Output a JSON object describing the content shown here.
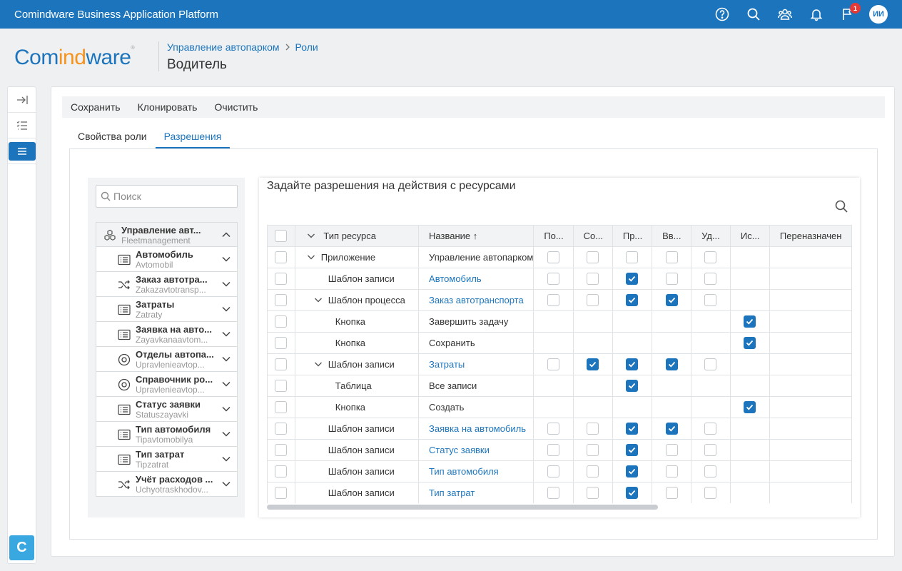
{
  "app": {
    "title": "Comindware Business Application Platform",
    "notifications_count": "1",
    "user_initials": "ИИ"
  },
  "logo": {
    "part1": "Com",
    "part2": "ind",
    "part3": "ware",
    "mark": "®"
  },
  "breadcrumb": {
    "items": [
      "Управление автопарком",
      "Роли"
    ]
  },
  "page": {
    "title": "Водитель"
  },
  "rail": {
    "logo_letter": "C"
  },
  "toolbar": {
    "save": "Сохранить",
    "clone": "Клонировать",
    "clear": "Очистить"
  },
  "tabs": [
    {
      "label": "Свойства роли"
    },
    {
      "label": "Разрешения"
    }
  ],
  "search": {
    "placeholder": "Поиск"
  },
  "tree": {
    "root": {
      "name": "Управление авт...",
      "sub": "Fleetmanagement"
    },
    "items": [
      {
        "name": "Автомобиль",
        "sub": "Avtomobil",
        "icon": "list-icon"
      },
      {
        "name": "Заказ автотра...",
        "sub": "Zakazavtotransp...",
        "icon": "shuffle-icon"
      },
      {
        "name": "Затраты",
        "sub": "Zatraty",
        "icon": "list-icon"
      },
      {
        "name": "Заявка на авто...",
        "sub": "Zayavkanaavtom...",
        "icon": "list-icon"
      },
      {
        "name": "Отделы автопа...",
        "sub": "Upravlenieavtop...",
        "icon": "circle-icon"
      },
      {
        "name": "Справочник ро...",
        "sub": "Upravlenieavtop...",
        "icon": "circle-icon"
      },
      {
        "name": "Статус заявки",
        "sub": "Statuszayavki",
        "icon": "list-icon"
      },
      {
        "name": "Тип автомобиля",
        "sub": "Tipavtomobilya",
        "icon": "list-icon"
      },
      {
        "name": "Тип затрат",
        "sub": "Tipzatrat",
        "icon": "list-icon"
      },
      {
        "name": "Учёт расходов ...",
        "sub": "Uchyotraskhodov...",
        "icon": "shuffle-icon"
      }
    ]
  },
  "grid": {
    "title": "Задайте разрешения на действия с ресурсами",
    "columns": [
      "Тип ресурса",
      "Название ↑",
      "По...",
      "Со...",
      "Пр...",
      "Вв...",
      "Уд...",
      "Ис...",
      "Переназначен"
    ],
    "rows": [
      {
        "type": "Приложение",
        "name": "Управление автопарком",
        "indent": 1,
        "expand": true,
        "link": false,
        "perms": [
          0,
          0,
          0,
          0,
          0,
          -1
        ]
      },
      {
        "type": "Шаблон записи",
        "name": "Автомобиль",
        "indent": 2,
        "expand": false,
        "link": true,
        "perms": [
          0,
          0,
          1,
          0,
          0,
          -1
        ]
      },
      {
        "type": "Шаблон процесса",
        "name": "Заказ автотранспорта",
        "indent": 2,
        "expand": true,
        "link": true,
        "perms": [
          0,
          0,
          1,
          1,
          0,
          -1
        ]
      },
      {
        "type": "Кнопка",
        "name": "Завершить задачу",
        "indent": 3,
        "expand": false,
        "link": false,
        "perms": [
          -1,
          -1,
          -1,
          -1,
          -1,
          1
        ]
      },
      {
        "type": "Кнопка",
        "name": "Сохранить",
        "indent": 3,
        "expand": false,
        "link": false,
        "perms": [
          -1,
          -1,
          -1,
          -1,
          -1,
          1
        ]
      },
      {
        "type": "Шаблон записи",
        "name": "Затраты",
        "indent": 2,
        "expand": true,
        "link": true,
        "perms": [
          0,
          1,
          1,
          1,
          0,
          -1
        ]
      },
      {
        "type": "Таблица",
        "name": "Все записи",
        "indent": 3,
        "expand": false,
        "link": false,
        "perms": [
          -1,
          -1,
          1,
          -1,
          -1,
          -1
        ]
      },
      {
        "type": "Кнопка",
        "name": "Создать",
        "indent": 3,
        "expand": false,
        "link": false,
        "perms": [
          -1,
          -1,
          -1,
          -1,
          -1,
          1
        ]
      },
      {
        "type": "Шаблон записи",
        "name": "Заявка на автомобиль",
        "indent": 2,
        "expand": false,
        "link": true,
        "perms": [
          0,
          0,
          1,
          1,
          0,
          -1
        ]
      },
      {
        "type": "Шаблон записи",
        "name": "Статус заявки",
        "indent": 2,
        "expand": false,
        "link": true,
        "perms": [
          0,
          0,
          1,
          0,
          0,
          -1
        ]
      },
      {
        "type": "Шаблон записи",
        "name": "Тип автомобиля",
        "indent": 2,
        "expand": false,
        "link": true,
        "perms": [
          0,
          0,
          1,
          0,
          0,
          -1
        ]
      },
      {
        "type": "Шаблон записи",
        "name": "Тип затрат",
        "indent": 2,
        "expand": false,
        "link": true,
        "perms": [
          0,
          0,
          1,
          0,
          0,
          -1
        ]
      }
    ]
  },
  "colors": {
    "primary": "#1c75bc",
    "accent": "#f7941d",
    "badge": "#e53935"
  }
}
